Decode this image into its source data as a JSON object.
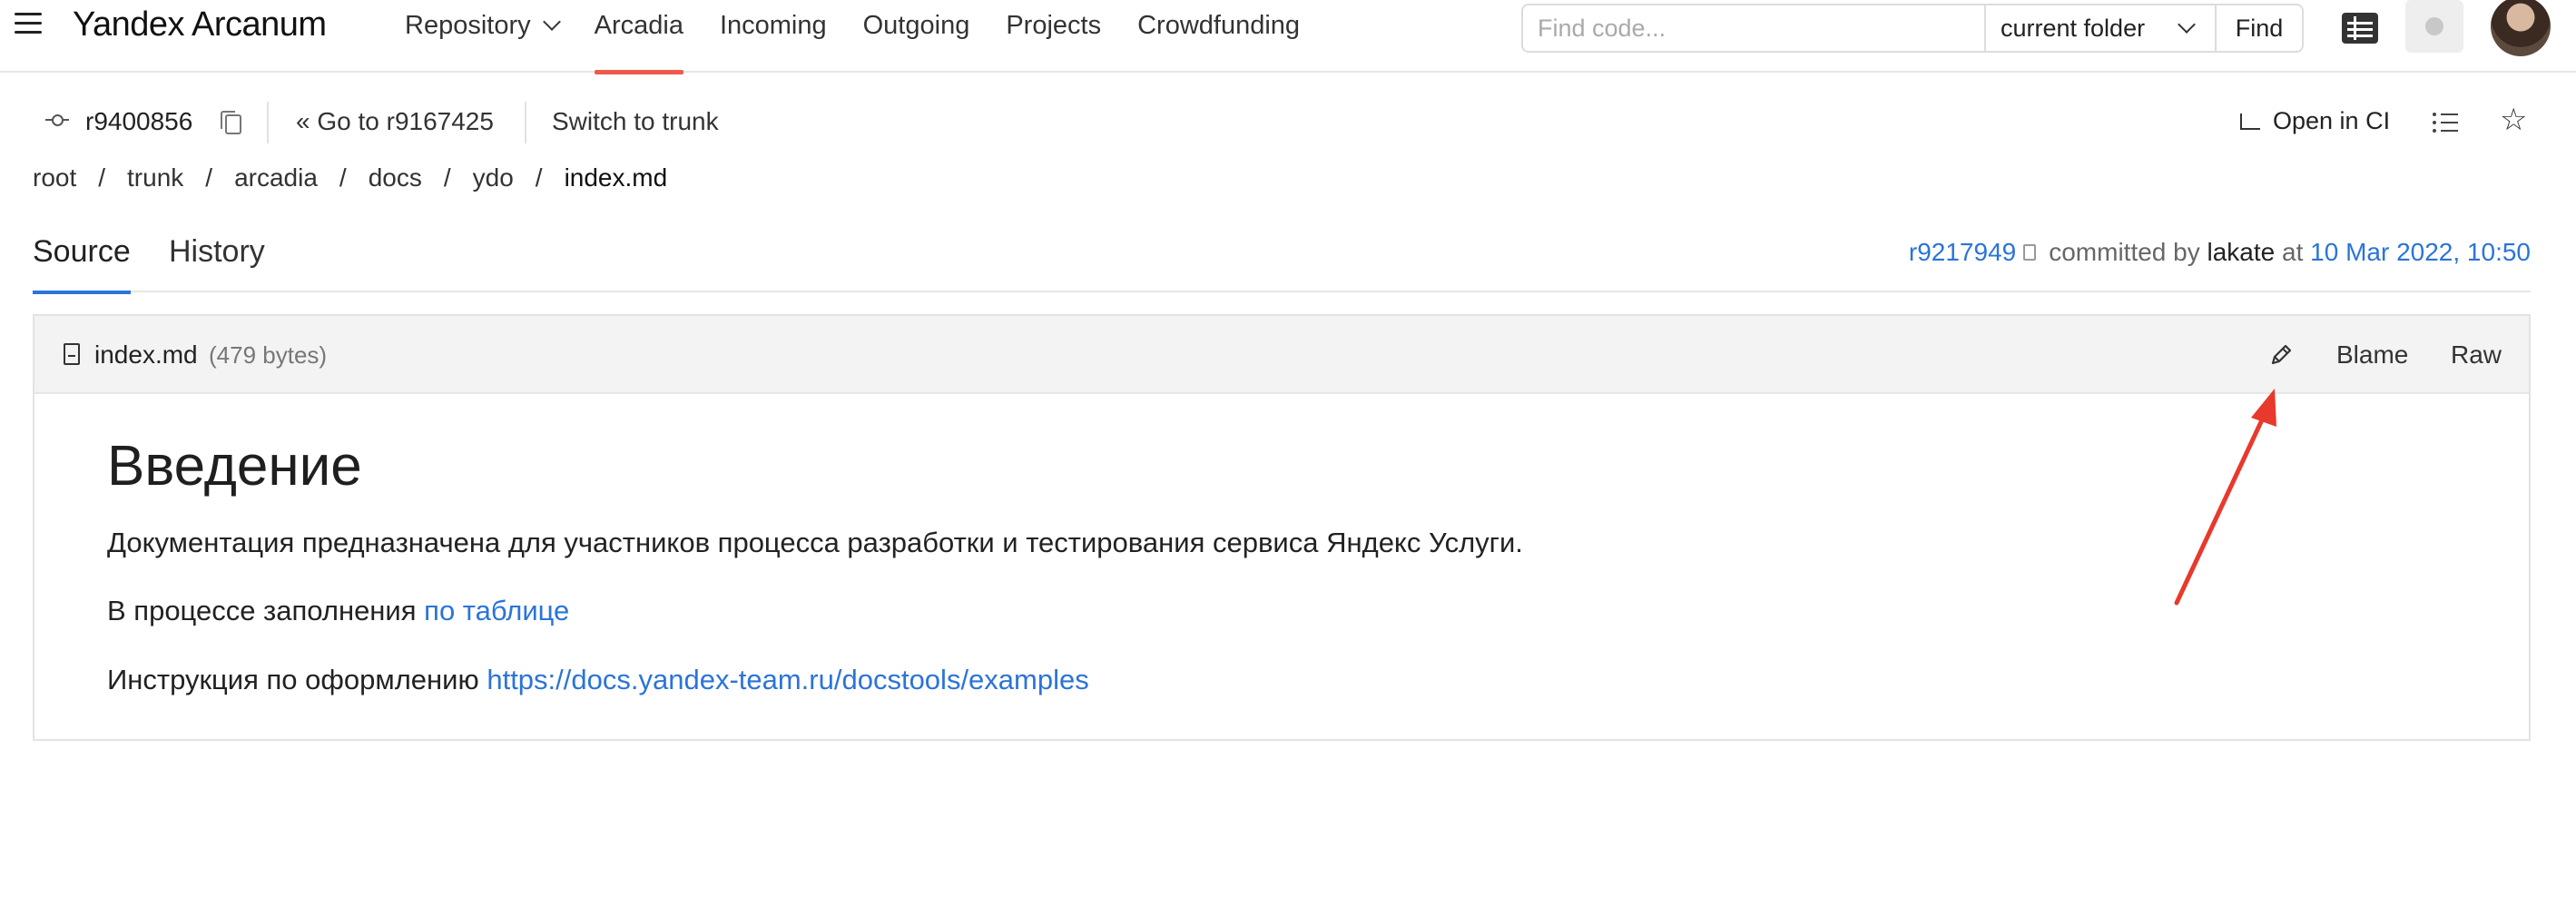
{
  "app": {
    "title": "Yandex Arcanum",
    "nav": [
      {
        "label": "Repository",
        "has_dropdown": true
      },
      {
        "label": "Arcadia",
        "active": true
      },
      {
        "label": "Incoming"
      },
      {
        "label": "Outgoing"
      },
      {
        "label": "Projects"
      },
      {
        "label": "Crowdfunding"
      }
    ],
    "search": {
      "placeholder": "Find code...",
      "value": "",
      "scope": "current folder",
      "button_label": "Find"
    },
    "accent_color": "#ee5a4b",
    "link_color": "#2b74d8"
  },
  "revision": {
    "id": "r9400856",
    "goto_label": "Go to r9167425",
    "switch_label": "Switch to trunk",
    "open_ci_label": "Open in CI"
  },
  "breadcrumb": {
    "items": [
      "root",
      "trunk",
      "arcadia",
      "docs",
      "ydo",
      "index.md"
    ],
    "separator": "/"
  },
  "tabs": {
    "source": "Source",
    "history": "History"
  },
  "commit": {
    "revision": "r9217949",
    "committed_by_label": "committed by",
    "author": "lakate",
    "at_label": "at",
    "date": "10 Mar 2022, 10:50"
  },
  "file": {
    "name": "index.md",
    "size": "(479 bytes)",
    "blame_label": "Blame",
    "raw_label": "Raw"
  },
  "content": {
    "heading": "Введение",
    "para1": "Документация предназначена для участников процесса разработки и тестирования сервиса Яндекс Услуги.",
    "para2_text": "В процессе заполнения ",
    "para2_link": "по таблице",
    "para3_text": "Инструкция по оформлению ",
    "para3_link": "https://docs.yandex-team.ru/docstools/examples"
  },
  "annotation": {
    "color": "#e8392c",
    "target": "edit-icon"
  }
}
